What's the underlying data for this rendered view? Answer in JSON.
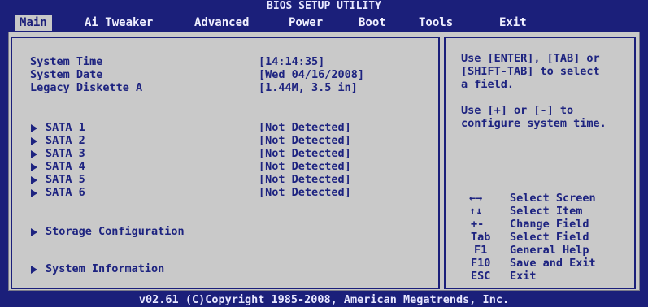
{
  "title": "BIOS SETUP UTILITY",
  "tabs": [
    {
      "label": "Main"
    },
    {
      "label": "Ai Tweaker"
    },
    {
      "label": "Advanced"
    },
    {
      "label": "Power"
    },
    {
      "label": "Boot"
    },
    {
      "label": "Tools"
    },
    {
      "label": "Exit"
    }
  ],
  "active_tab": "Main",
  "settings": [
    {
      "label": "System Time",
      "value": "[14:14:35]"
    },
    {
      "label": "System Date",
      "value": "[Wed 04/16/2008]"
    },
    {
      "label": "Legacy Diskette A",
      "value": "[1.44M, 3.5 in]"
    }
  ],
  "sata": [
    {
      "label": "SATA 1",
      "value": "[Not Detected]"
    },
    {
      "label": "SATA 2",
      "value": "[Not Detected]"
    },
    {
      "label": "SATA 3",
      "value": "[Not Detected]"
    },
    {
      "label": "SATA 4",
      "value": "[Not Detected]"
    },
    {
      "label": "SATA 5",
      "value": "[Not Detected]"
    },
    {
      "label": "SATA 6",
      "value": "[Not Detected]"
    }
  ],
  "submenus": [
    {
      "label": "Storage Configuration"
    },
    {
      "label": "System Information"
    }
  ],
  "help_lines": [
    "Use [ENTER], [TAB] or",
    "[SHIFT-TAB] to select",
    "a field.",
    "",
    "Use [+] or [-] to",
    "configure system time."
  ],
  "keys": [
    {
      "key": "←→",
      "action": "Select Screen"
    },
    {
      "key": "↑↓",
      "action": "Select Item"
    },
    {
      "key": "+-",
      "action": "Change Field"
    },
    {
      "key": "Tab",
      "action": "Select Field"
    },
    {
      "key": "F1",
      "action": "General Help"
    },
    {
      "key": "F10",
      "action": "Save and Exit"
    },
    {
      "key": "ESC",
      "action": "Exit"
    }
  ],
  "footer": "v02.61 (C)Copyright 1985-2008, American Megatrends, Inc.",
  "colors": {
    "background": "#1b1f7a",
    "panel": "#c9c9c9",
    "text": "#1d2380"
  }
}
